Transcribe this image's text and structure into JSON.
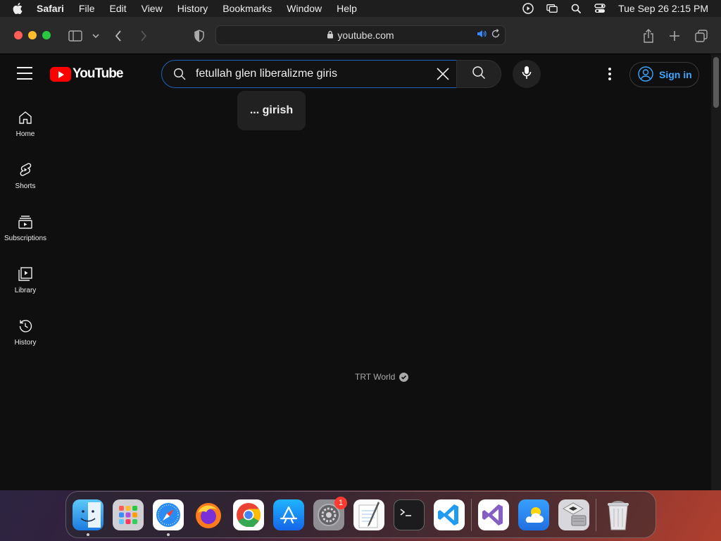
{
  "menubar": {
    "app_name": "Safari",
    "menus": [
      "File",
      "Edit",
      "View",
      "History",
      "Bookmarks",
      "Window",
      "Help"
    ],
    "clock": "Tue Sep 26  2:15 PM"
  },
  "browser": {
    "url": "youtube.com"
  },
  "youtube": {
    "logo_text": "YouTube",
    "search": {
      "query": "fetullah glen liberalizme giris"
    },
    "suggestion": "... girish",
    "sign_in": "Sign in",
    "guide": [
      {
        "label": "Home",
        "icon": "home-icon"
      },
      {
        "label": "Shorts",
        "icon": "shorts-icon"
      },
      {
        "label": "Subscriptions",
        "icon": "subscriptions-icon"
      },
      {
        "label": "Library",
        "icon": "library-icon"
      },
      {
        "label": "History",
        "icon": "history-icon"
      }
    ],
    "channel_name": "TRT World"
  },
  "dock": {
    "apps": [
      "Finder",
      "Launchpad",
      "Safari",
      "Firefox",
      "Chrome",
      "App Store",
      "System Settings",
      "TextEdit",
      "Terminal",
      "Visual Studio Code",
      "Visual Studio",
      "Weather",
      "Boot Camp Assistant",
      "Trash"
    ],
    "settings_badge": "1"
  },
  "colors": {
    "yt_red": "#ff0000",
    "signin_blue": "#3ea6ff",
    "search_focus": "#1c62b9",
    "background": "#0f0f0f"
  }
}
